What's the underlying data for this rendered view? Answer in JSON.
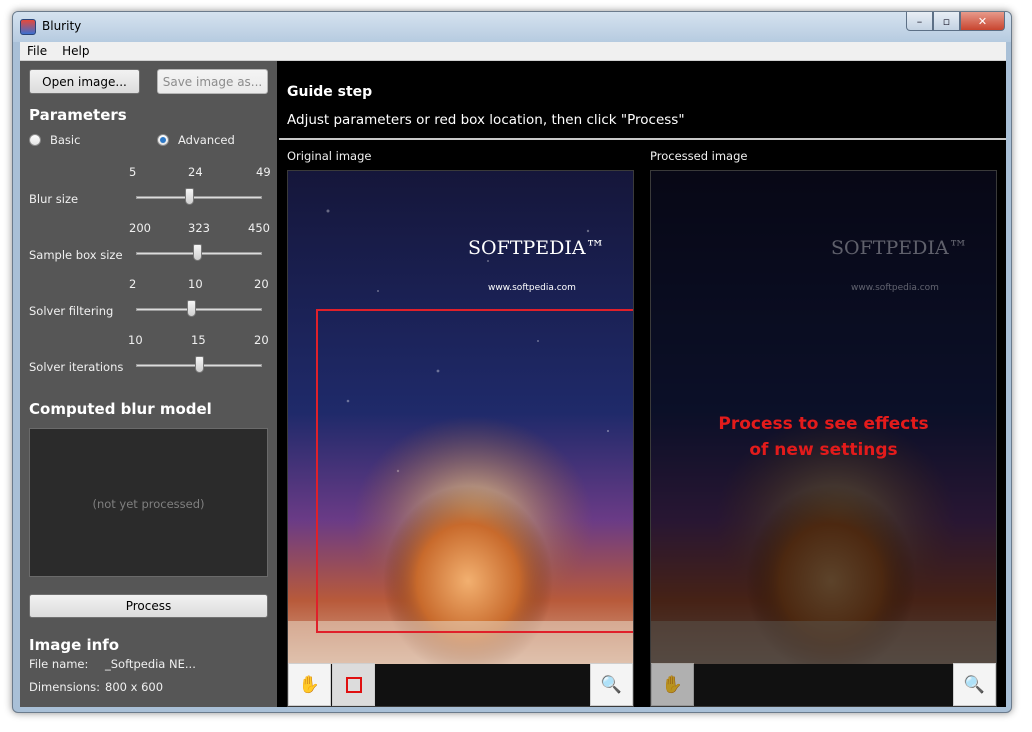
{
  "window": {
    "title": "Blurity"
  },
  "window_controls": {
    "minimize": "–",
    "maximize": "▫",
    "close": "✕"
  },
  "menu": [
    "File",
    "Help"
  ],
  "buttons": {
    "open": "Open image...",
    "save": "Save image as...",
    "process": "Process"
  },
  "parameters": {
    "title": "Parameters",
    "mode_options": [
      "Basic",
      "Advanced"
    ],
    "selected_mode": "Advanced",
    "sliders": [
      {
        "label": "Blur size",
        "min": "5",
        "value": "24",
        "max": "49",
        "position": 0.42
      },
      {
        "label": "Sample box size",
        "min": "200",
        "value": "323",
        "max": "450",
        "position": 0.49
      },
      {
        "label": "Solver filtering",
        "min": "2",
        "value": "10",
        "max": "20",
        "position": 0.44
      },
      {
        "label": "Solver iterations",
        "min": "10",
        "value": "15",
        "max": "20",
        "position": 0.5
      }
    ]
  },
  "blur_model": {
    "title": "Computed blur model",
    "placeholder": "(not yet processed)"
  },
  "image_info": {
    "title": "Image info",
    "file_name_label": "File name:",
    "file_name_value": "_Softpedia NE...",
    "dimensions_label": "Dimensions:",
    "dimensions_value": "800 x 600"
  },
  "guide": {
    "title": "Guide step",
    "text": "Adjust parameters or red box location, then click \"Process\""
  },
  "panes": {
    "original_label": "Original image",
    "processed_label": "Processed image",
    "overlay_line1": "Process to see effects",
    "overlay_line2": "of new settings"
  },
  "image_watermark": {
    "brand": "SOFTPEDIA™",
    "url": "www.softpedia.com"
  },
  "icons": {
    "hand": "hand-icon",
    "rectangle": "rectangle-select-icon",
    "zoom": "zoom-icon"
  },
  "colors": {
    "accent_red": "#e31b1b",
    "panel_bg": "#565656",
    "client_bg": "#000000"
  }
}
